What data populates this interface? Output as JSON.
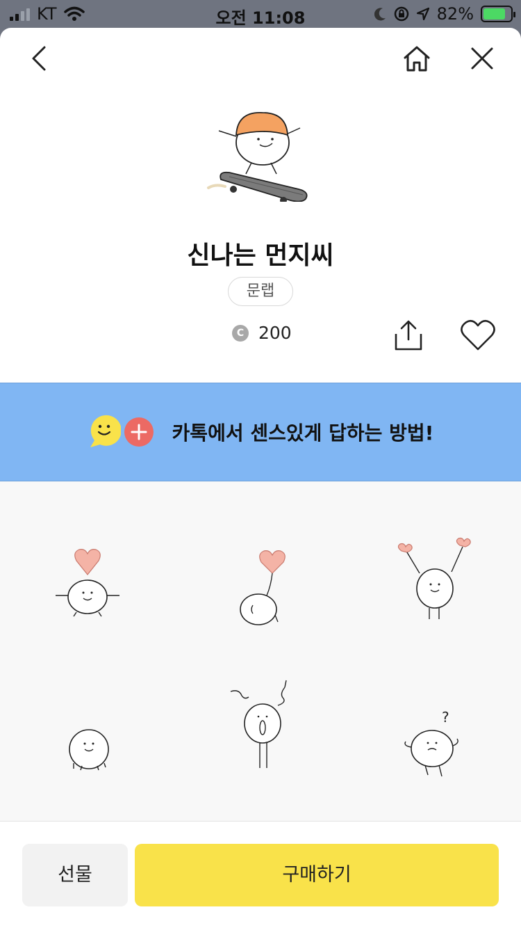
{
  "status_bar": {
    "carrier": "KT",
    "time": "오전 11:08",
    "battery": "82%",
    "battery_level": 0.82
  },
  "nav": {
    "back_icon": "chevron-left-icon",
    "home_icon": "home-icon",
    "close_icon": "close-icon"
  },
  "product": {
    "title": "신나는 먼지씨",
    "tag": "문랩",
    "coin_symbol": "C",
    "price": "200"
  },
  "banner": {
    "text": "카톡에서 센스있게 답하는 방법!"
  },
  "actions": {
    "gift_label": "선물",
    "buy_label": "구매하기"
  },
  "colors": {
    "banner": "#80b6f3",
    "buy_button": "#f9e24a",
    "heart_accent": "#f4b3a6",
    "hat": "#f4a261"
  }
}
